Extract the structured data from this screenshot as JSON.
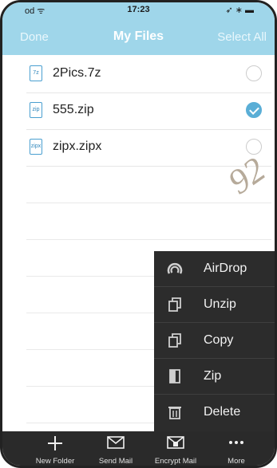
{
  "status_bar": {
    "carrier": "od ᯤ",
    "time": "17:23",
    "indicators": "➶ ∗ ▬"
  },
  "nav": {
    "left_button": "Done",
    "title": "My Files",
    "right_button": "Select All"
  },
  "files": [
    {
      "icon_text": "7z",
      "name": "2Pics.7z",
      "selected": false
    },
    {
      "icon_text": "zip",
      "name": "555.zip",
      "selected": true
    },
    {
      "icon_text": "zipx",
      "name": "zipx.zipx",
      "selected": false
    }
  ],
  "watermark": "92",
  "menu": [
    {
      "icon": "airdrop-icon",
      "label": "AirDrop"
    },
    {
      "icon": "unzip-icon",
      "label": "Unzip"
    },
    {
      "icon": "copy-icon",
      "label": "Copy"
    },
    {
      "icon": "zip-icon",
      "label": "Zip"
    },
    {
      "icon": "trash-icon",
      "label": "Delete"
    }
  ],
  "toolbar": [
    {
      "icon": "plus-icon",
      "label": "New Folder"
    },
    {
      "icon": "mail-icon",
      "label": "Send Mail"
    },
    {
      "icon": "encrypt-mail-icon",
      "label": "Encrypt Mail"
    },
    {
      "icon": "more-icon",
      "label": "More"
    }
  ],
  "colors": {
    "accent": "#9fd6ea",
    "check": "#5aaed6",
    "menu_bg": "#2c2c2c",
    "toolbar_bg": "#2a2a2a"
  }
}
